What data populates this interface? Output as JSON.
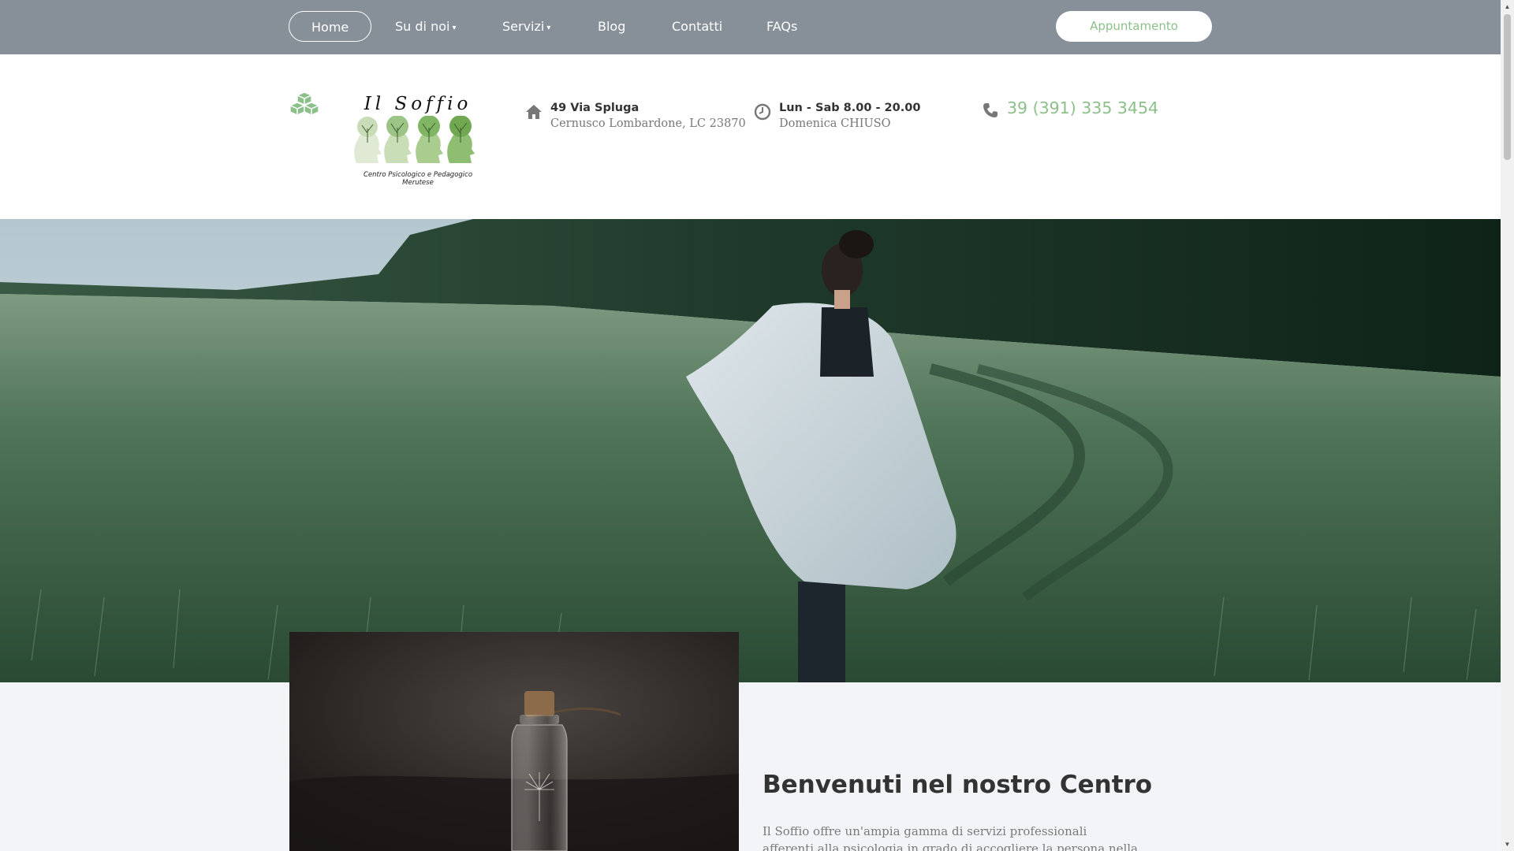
{
  "nav": {
    "items": [
      {
        "label": "Home"
      },
      {
        "label": "Su di noi"
      },
      {
        "label": "Servizi"
      },
      {
        "label": "Blog"
      },
      {
        "label": "Contatti"
      },
      {
        "label": "FAQs"
      }
    ],
    "caret": "▾",
    "cta_label": "Appuntamento"
  },
  "logo": {
    "title": "Il Soffio",
    "subtitle": "Centro Psicologico e Pedagogico Merutese"
  },
  "contact": {
    "address_line1": "49 Via Spluga",
    "address_line2": "Cernusco Lombardone, LC 23870",
    "hours_line1": "Lun - Sab 8.00 - 20.00",
    "hours_line2": "Domenica CHIUSO",
    "phone": "39 (391) 335 3454"
  },
  "intro": {
    "title": "Benvenuti nel nostro Centro",
    "text": "Il Soffio offre un'ampia gamma di servizi professionali afferenti alla psicologia in grado di accogliere la persona nella sua soggettività"
  },
  "icons": {
    "brand": "cubes-icon",
    "address": "home-icon",
    "hours": "clock-icon",
    "phone": "phone-icon"
  },
  "colors": {
    "nav_bg": "#878f99",
    "accent": "#8cc08a",
    "section_bg": "#f3f4f7"
  }
}
